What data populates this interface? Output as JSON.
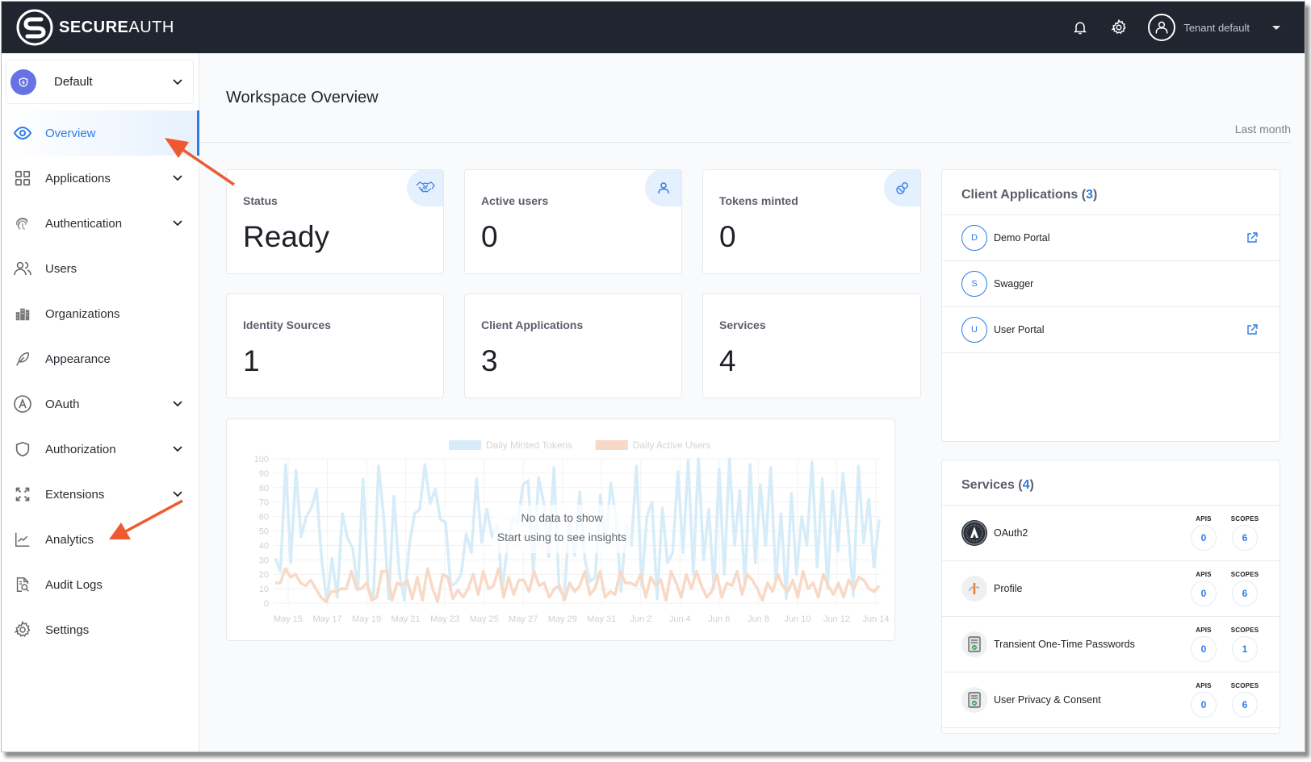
{
  "brand": {
    "name_bold": "SECURE",
    "name_light": "AUTH"
  },
  "topbar": {
    "tenant_label": "Tenant default"
  },
  "workspace": {
    "selected": "Default"
  },
  "sidebar": {
    "items": [
      {
        "label": "Overview",
        "icon": "eye-icon",
        "has_chevron": false,
        "active": true
      },
      {
        "label": "Applications",
        "icon": "grid-icon",
        "has_chevron": true
      },
      {
        "label": "Authentication",
        "icon": "fingerprint-icon",
        "has_chevron": true
      },
      {
        "label": "Users",
        "icon": "users-icon",
        "has_chevron": false
      },
      {
        "label": "Organizations",
        "icon": "buildings-icon",
        "has_chevron": false
      },
      {
        "label": "Appearance",
        "icon": "feather-icon",
        "has_chevron": false
      },
      {
        "label": "OAuth",
        "icon": "oauth-icon",
        "has_chevron": true
      },
      {
        "label": "Authorization",
        "icon": "shield-icon",
        "has_chevron": true
      },
      {
        "label": "Extensions",
        "icon": "expand-icon",
        "has_chevron": true
      },
      {
        "label": "Analytics",
        "icon": "chart-line-icon",
        "has_chevron": false
      },
      {
        "label": "Audit Logs",
        "icon": "audit-search-icon",
        "has_chevron": false
      },
      {
        "label": "Settings",
        "icon": "gear-icon",
        "has_chevron": false
      }
    ]
  },
  "main": {
    "title": "Workspace Overview",
    "range": "Last month",
    "stats": [
      {
        "label": "Status",
        "value": "Ready",
        "icon": "handshake-icon"
      },
      {
        "label": "Active users",
        "value": "0",
        "icon": "user-icon"
      },
      {
        "label": "Tokens minted",
        "value": "0",
        "icon": "pill-icon"
      },
      {
        "label": "Identity Sources",
        "value": "1"
      },
      {
        "label": "Client Applications",
        "value": "3"
      },
      {
        "label": "Services",
        "value": "4"
      }
    ],
    "chart_overlay": {
      "line1": "No data to show",
      "line2": "Start using to see insights"
    }
  },
  "client_apps": {
    "title": "Client Applications",
    "count": "3",
    "items": [
      {
        "initial": "D",
        "name": "Demo Portal",
        "external_link": true
      },
      {
        "initial": "S",
        "name": "Swagger",
        "external_link": false
      },
      {
        "initial": "U",
        "name": "User Portal",
        "external_link": true
      }
    ]
  },
  "services": {
    "title": "Services",
    "count": "4",
    "apis_label": "APIS",
    "scopes_label": "SCOPES",
    "items": [
      {
        "name": "OAuth2",
        "icon": "oauth2-badge-icon",
        "apis": "0",
        "scopes": "6"
      },
      {
        "name": "Profile",
        "icon": "openid-icon",
        "apis": "0",
        "scopes": "6"
      },
      {
        "name": "Transient One-Time Passwords",
        "icon": "document-check-icon",
        "apis": "0",
        "scopes": "1"
      },
      {
        "name": "User Privacy & Consent",
        "icon": "document-check-icon",
        "apis": "0",
        "scopes": "6"
      }
    ]
  },
  "colors": {
    "accent": "#2f7be6",
    "topbar": "#212530",
    "tokens_series": "#d6ecf9",
    "users_series": "#f8d9c6"
  },
  "chart_data": {
    "type": "line",
    "title": "",
    "placeholder": true,
    "legend": [
      "Daily Minted Tokens",
      "Daily Active Users"
    ],
    "legend_position": "top",
    "x": [
      "May 15",
      "May 17",
      "May 19",
      "May 21",
      "May 23",
      "May 25",
      "May 27",
      "May 29",
      "May 31",
      "Jun 2",
      "Jun 4",
      "Jun 6",
      "Jun 8",
      "Jun 10",
      "Jun 12",
      "Jun 14"
    ],
    "y_ticks": [
      0,
      10,
      20,
      30,
      40,
      50,
      60,
      70,
      80,
      90,
      100
    ],
    "ylim": [
      0,
      100
    ],
    "grid": true,
    "series": [
      {
        "name": "Daily Minted Tokens",
        "color": "#d6ecf9",
        "values": [
          31,
          22,
          96,
          28,
          92,
          46,
          60,
          66,
          79,
          30,
          1,
          31,
          4,
          62,
          45,
          38,
          9,
          86,
          10,
          4,
          95,
          60,
          3,
          74,
          22,
          2,
          41,
          62,
          65,
          96,
          69,
          79,
          58,
          56,
          12,
          14,
          20,
          48,
          35,
          86,
          42,
          65,
          46,
          54,
          10,
          40,
          60,
          56,
          82,
          85,
          20,
          87,
          70,
          32,
          94,
          10,
          4,
          59,
          33,
          77,
          30,
          15,
          18,
          75,
          41,
          83,
          60,
          8,
          55,
          40,
          95,
          12,
          60,
          70,
          3,
          66,
          28,
          35,
          91,
          35,
          99,
          20,
          100,
          30,
          65,
          10,
          93,
          20,
          100,
          40,
          78,
          12,
          96,
          28,
          82,
          40,
          94,
          15,
          62,
          3,
          76,
          20,
          60,
          40,
          98,
          25,
          86,
          10,
          78,
          36,
          90,
          52,
          5,
          95,
          42,
          72,
          25,
          58
        ]
      },
      {
        "name": "Daily Active Users",
        "color": "#f8d9c6",
        "values": [
          14,
          14,
          24,
          18,
          20,
          14,
          12,
          16,
          10,
          4,
          1,
          8,
          8,
          10,
          10,
          22,
          10,
          10,
          14,
          2,
          4,
          22,
          22,
          2,
          14,
          12,
          16,
          3,
          18,
          2,
          24,
          10,
          1,
          20,
          18,
          3,
          9,
          4,
          10,
          20,
          6,
          22,
          10,
          12,
          24,
          4,
          18,
          6,
          16,
          16,
          8,
          22,
          12,
          14,
          4,
          10,
          12,
          2,
          14,
          8,
          12,
          22,
          6,
          10,
          22,
          4,
          8,
          6,
          22,
          14,
          14,
          12,
          20,
          4,
          18,
          12,
          16,
          2,
          22,
          14,
          4,
          20,
          10,
          22,
          12,
          4,
          8,
          20,
          4,
          14,
          12,
          22,
          6,
          20,
          16,
          10,
          2,
          14,
          8,
          20,
          12,
          8,
          16,
          4,
          22,
          10,
          14,
          4,
          20,
          12,
          6,
          14,
          4,
          16,
          10,
          18,
          16,
          10,
          8,
          12
        ]
      }
    ]
  }
}
